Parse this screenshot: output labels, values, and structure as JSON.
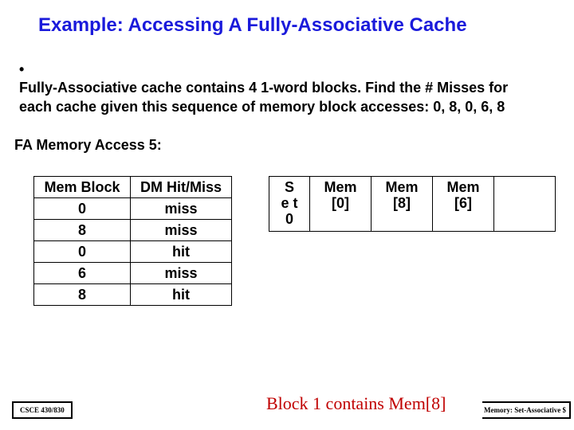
{
  "title": "Example: Accessing A Fully-Associative Cache",
  "bullet": "Fully-Associative cache contains 4 1-word blocks. Find the # Misses for each cache given this sequence of memory block accesses: 0, 8, 0, 6, 8",
  "subhead": "FA Memory Access 5:",
  "table1": {
    "headers": [
      "Mem Block",
      "DM Hit/Miss"
    ],
    "rows": [
      [
        "0",
        "miss"
      ],
      [
        "8",
        "miss"
      ],
      [
        "0",
        "hit"
      ],
      [
        "6",
        "miss"
      ],
      [
        "8",
        "hit"
      ]
    ]
  },
  "table2": {
    "headers": [
      "S e t",
      "Mem [0]",
      "Mem [8]",
      "Mem [6]",
      ""
    ],
    "row": [
      "0",
      "",
      "",
      "",
      ""
    ]
  },
  "conclusion": "Block 1 contains Mem[8]",
  "footer_left": "CSCE 430/830",
  "footer_right": "Memory: Set-Associative $",
  "chart_data": {
    "type": "table",
    "title": "FA Memory Access 5",
    "series": [
      {
        "name": "Mem Block",
        "values": [
          0,
          8,
          0,
          6,
          8
        ]
      },
      {
        "name": "DM Hit/Miss",
        "values": [
          "miss",
          "miss",
          "hit",
          "miss",
          "hit"
        ]
      }
    ],
    "cache_state": {
      "set": 0,
      "blocks": [
        "Mem[0]",
        "Mem[8]",
        "Mem[6]",
        null
      ]
    }
  }
}
